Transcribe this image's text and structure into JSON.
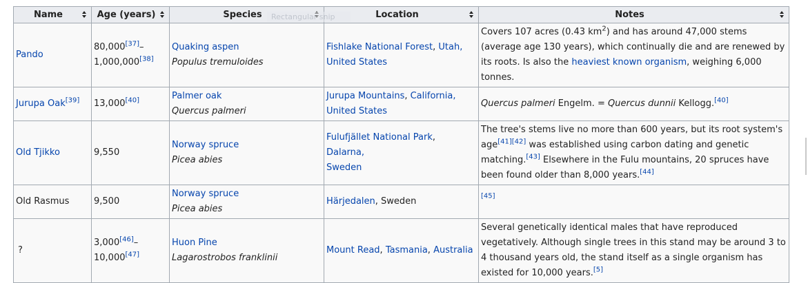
{
  "headers": {
    "name": "Name",
    "age": "Age (years)",
    "species": "Species",
    "location": "Location",
    "notes": "Notes"
  },
  "ghost_label": "Rectangular snip",
  "rows": [
    {
      "name": "Pando",
      "age_a": "80,000",
      "age_a_ref": "[37]",
      "age_dash": "–",
      "age_b": "1,000,000",
      "age_b_ref": "[38]",
      "species_link": "Quaking aspen",
      "species_latin": "Populus tremuloides",
      "loc_1": "Fishlake National Forest",
      "loc_sep": ", ",
      "loc_2": "Utah",
      "loc_sep2": ",",
      "loc_3": "United States",
      "note_1": "Covers 107 acres (0.43 km",
      "note_sup": "2",
      "note_2": ") and has around 47,000 stems (average age 130 years), which continually die and are renewed by its roots. Is also the ",
      "note_link": "heaviest known organism",
      "note_3": ", weighing 6,000 tonnes."
    },
    {
      "name": "Jurupa Oak",
      "name_ref": "[39]",
      "age": "13,000",
      "age_ref": "[40]",
      "species_link": "Palmer oak",
      "species_latin": "Quercus palmeri",
      "loc_1": "Jurupa Mountains",
      "loc_sep": ", ",
      "loc_2": "California",
      "loc_sep2": ",",
      "loc_3": "United States",
      "note_it1": "Quercus palmeri",
      "note_1": " Engelm. = ",
      "note_it2": "Quercus dunnii",
      "note_2": " Kellogg.",
      "note_ref": "[40]"
    },
    {
      "name": "Old Tjikko",
      "age": "9,550",
      "species_link": "Norway spruce",
      "species_latin": "Picea abies",
      "loc_1": "Fulufjället National Park",
      "loc_sep": ", ",
      "loc_2": "Dalarna",
      "loc_sep2": ",",
      "loc_3": "Sweden",
      "note_1": "The tree's stems live no more than 600 years, but its root system's age",
      "note_ref1": "[41][42]",
      "note_2": " was established using carbon dating and genetic matching.",
      "note_ref2": "[43]",
      "note_3": " Elsewhere in the Fulu mountains, 20 spruces have been found older than 8,000 years.",
      "note_ref3": "[44]"
    },
    {
      "name": "Old Rasmus",
      "age": "9,500",
      "species_link": "Norway spruce",
      "species_latin": "Picea abies",
      "loc_1": "Härjedalen",
      "loc_rest": ", Sweden",
      "note_ref": "[45]"
    },
    {
      "name": "?",
      "age_a": "3,000",
      "age_a_ref": "[46]",
      "age_dash": "–",
      "age_b": "10,000",
      "age_b_ref": "[47]",
      "species_link": "Huon Pine",
      "species_latin": "Lagarostrobos franklinii",
      "loc_1": "Mount Read",
      "loc_sep": ", ",
      "loc_2": "Tasmania",
      "loc_sep2": ", ",
      "loc_3": "Australia",
      "note_1": "Several genetically identical males that have reproduced vegetatively. Although single trees in this stand may be around 3 to 4 thousand years old, the stand itself as a single organism has existed for 10,000 years.",
      "note_ref": "[5]"
    }
  ]
}
